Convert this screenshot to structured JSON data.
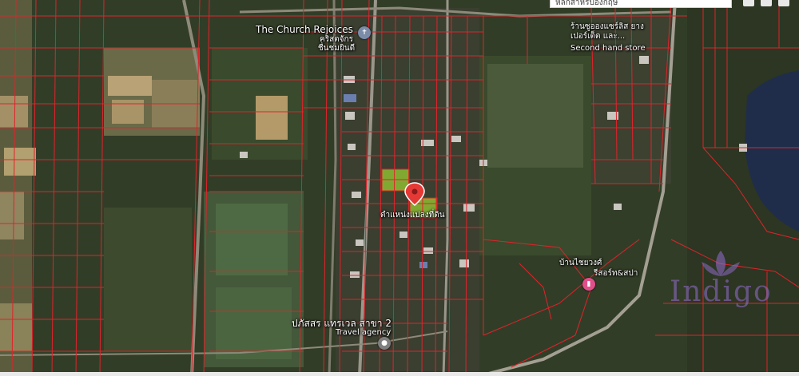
{
  "search": {
    "value": "หลักสำหรับอังกฤษ"
  },
  "colors": {
    "parcel_line": "#e0232b",
    "highlight_parcel": "#9acd32",
    "pin": "#e53935",
    "water": "#1f2d4a"
  },
  "pois": [
    {
      "id": "church",
      "name": "The Church Rejoices",
      "sub": "คริสตจักร ชื่นชมยินดี",
      "icon": "place-of-worship-icon"
    },
    {
      "id": "secondhand",
      "name": "ร้านซูอองแซร์ลิส ยางเปอร์เต็ต และ...",
      "sub": "Second hand store",
      "icon": ""
    },
    {
      "id": "resort",
      "name": "บ้านไชยวงศ์",
      "sub": "รีสอร์ท&สปา",
      "icon": "hotel-icon"
    },
    {
      "id": "travel",
      "name": "ปภัสสร แทรเวล สาขา 2",
      "sub": "Travel agency",
      "icon": "place-icon"
    }
  ],
  "pin_label": "ตำแหน่งแปลงที่ดิน",
  "watermark": {
    "brand": "Indigo",
    "sub": ""
  }
}
